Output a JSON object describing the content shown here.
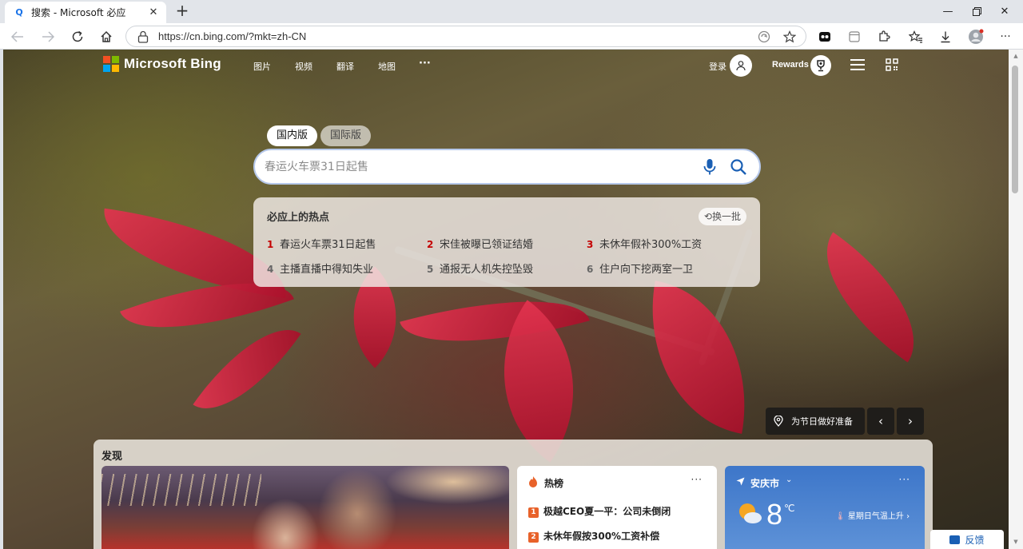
{
  "browser": {
    "tab_title": "搜索 - Microsoft 必应",
    "url": "https://cn.bing.com/?mkt=zh-CN"
  },
  "header": {
    "brand": "Microsoft Bing",
    "nav": [
      "图片",
      "视频",
      "翻译",
      "地图",
      "···"
    ],
    "login": "登录",
    "rewards": "Rewards"
  },
  "search": {
    "scopes": [
      "国内版",
      "国际版"
    ],
    "active_scope": "国内版",
    "placeholder": "春运火车票31日起售"
  },
  "hot": {
    "title": "必应上的热点",
    "refresh": "换一批",
    "items": [
      {
        "rank": "1",
        "text": "春运火车票31日起售"
      },
      {
        "rank": "2",
        "text": "宋佳被曝已领证结婚"
      },
      {
        "rank": "3",
        "text": "未休年假补300%工资"
      },
      {
        "rank": "4",
        "text": "主播直播中得知失业"
      },
      {
        "rank": "5",
        "text": "通报无人机失控坠毁"
      },
      {
        "rank": "6",
        "text": "住户向下挖两室一卫"
      }
    ]
  },
  "image": {
    "caption": "为节日做好准备",
    "prev": "‹",
    "next": "›"
  },
  "discover": {
    "title": "发现",
    "hotcard": {
      "title": "热榜",
      "more": "···",
      "items": [
        {
          "rank": "1",
          "text": "极越CEO夏一平：公司未倒闭"
        },
        {
          "rank": "2",
          "text": "未休年假按300%工资补偿"
        }
      ]
    },
    "weather": {
      "city": "安庆市",
      "temp": "8",
      "unit": "℃",
      "tip": "星期日气温上升",
      "more": "···"
    }
  },
  "feedback": "反馈",
  "colors": {
    "ms_red": "#f25022",
    "ms_green": "#7fba00",
    "ms_blue": "#00a4ef",
    "ms_yellow": "#ffb900",
    "hot_rank_red": "#c40000",
    "accent_blue": "#1a5fb4"
  }
}
